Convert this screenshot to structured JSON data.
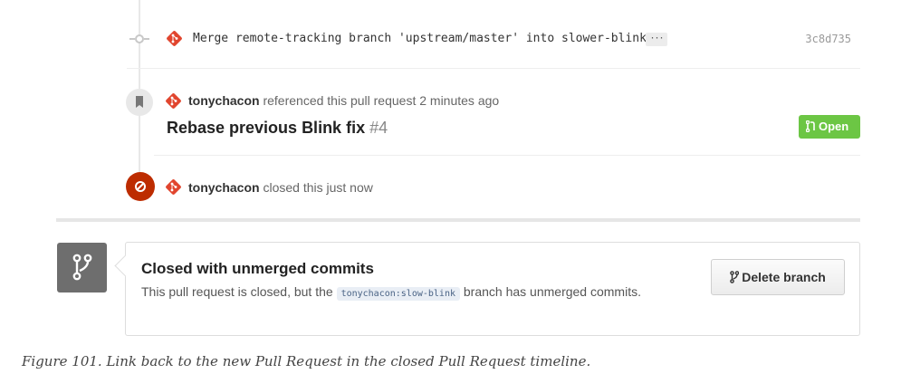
{
  "commit": {
    "message": "Merge remote-tracking branch 'upstream/master' into slower-blink",
    "ellipsis": "···",
    "sha": "3c8d735"
  },
  "reference": {
    "user": "tonychacon",
    "text": " referenced this pull request 2 minutes ago",
    "pr_title": "Rebase previous Blink fix",
    "pr_number": "#4",
    "status": "Open"
  },
  "closed_event": {
    "user": "tonychacon",
    "text": " closed this just now"
  },
  "merge_status": {
    "title": "Closed with unmerged commits",
    "desc_before": "This pull request is closed, but the ",
    "branch": "tonychacon:slow-blink",
    "desc_after": " branch has unmerged commits.",
    "delete_button": "Delete branch"
  },
  "caption": "Figure 101. Link back to the new Pull Request in the closed Pull Request timeline.",
  "colors": {
    "git_icon": "#e1452e",
    "open_badge": "#6cc644",
    "closed_badge": "#bd2c00",
    "merge_icon_bg": "#6e6e6e"
  },
  "icons": [
    "commit-icon",
    "git-logo-icon",
    "bookmark-icon",
    "pull-request-icon",
    "closed-icon",
    "branch-icon"
  ]
}
